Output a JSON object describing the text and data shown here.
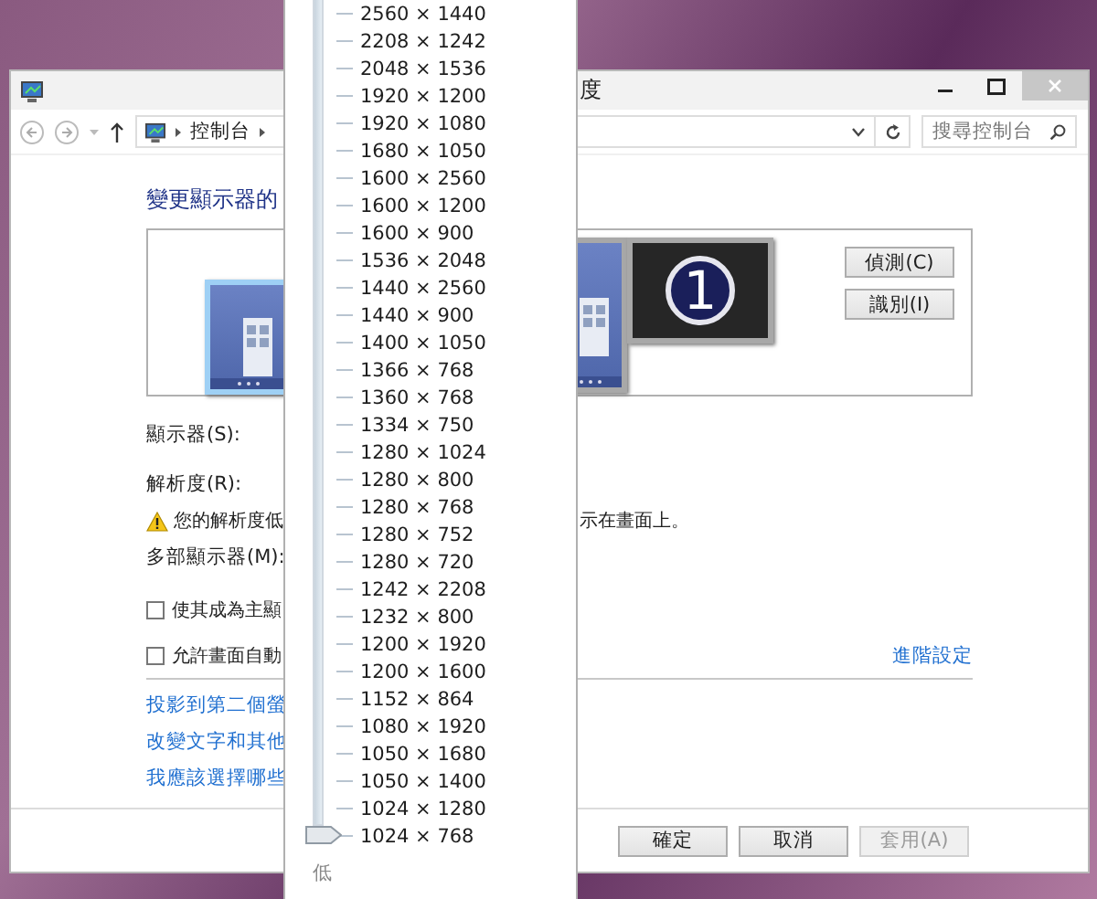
{
  "window": {
    "title": "度"
  },
  "address_bar": {
    "breadcrumb": [
      "控制台"
    ],
    "search": {
      "placeholder": "搜尋控制台"
    }
  },
  "heading": "變更顯示器的",
  "monitors": [
    {
      "kind": "desktop",
      "selected": true
    },
    {
      "kind": "desktop",
      "selected": false
    },
    {
      "kind": "dark",
      "number": "1",
      "selected": false
    }
  ],
  "detect_buttons": [
    "偵測(C)",
    "識別(I)"
  ],
  "fields": [
    "顯示器(S):",
    "解析度(R):"
  ],
  "warning": {
    "text_left": "您的解析度低",
    "text_right": "示在畫面上。"
  },
  "multi_display_label": "多部顯示器(M):",
  "checkboxes": [
    {
      "label": "使其成為主顯",
      "checked": false
    },
    {
      "label": "允許畫面自動",
      "checked": false
    }
  ],
  "advanced_link": "進階設定",
  "links": [
    "投影到第二個螢",
    "改變文字和其他",
    "我應該選擇哪些"
  ],
  "dialog_buttons": [
    {
      "label": "確定",
      "disabled": false
    },
    {
      "label": "取消",
      "disabled": false
    },
    {
      "label": "套用(A)",
      "disabled": true
    }
  ],
  "resolution_dropdown": {
    "options": [
      "2560 × 1440",
      "2208 × 1242",
      "2048 × 1536",
      "1920 × 1200",
      "1920 × 1080",
      "1680 × 1050",
      "1600 × 2560",
      "1600 × 1200",
      "1600 × 900",
      "1536 × 2048",
      "1440 × 2560",
      "1440 × 900",
      "1400 × 1050",
      "1366 × 768",
      "1360 × 768",
      "1334 × 750",
      "1280 × 1024",
      "1280 × 800",
      "1280 × 768",
      "1280 × 752",
      "1280 × 720",
      "1242 × 2208",
      "1232 × 800",
      "1200 × 1920",
      "1200 × 1600",
      "1152 × 864",
      "1080 × 1920",
      "1050 × 1680",
      "1050 × 1400",
      "1024 × 1280",
      "1024 × 768"
    ],
    "level": 0,
    "low_label": "低"
  }
}
